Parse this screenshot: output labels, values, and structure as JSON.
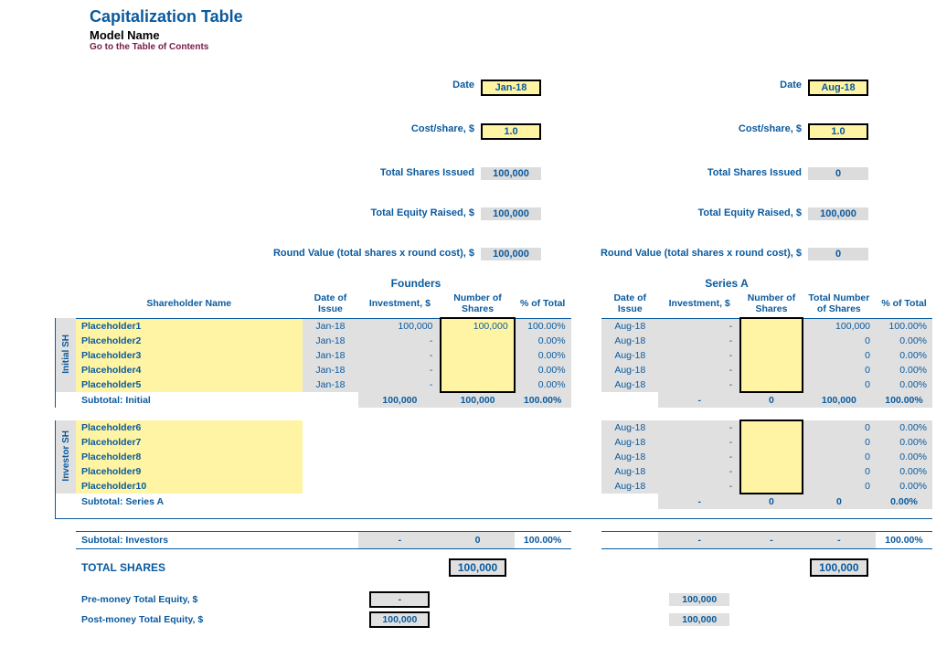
{
  "header": {
    "title": "Capitalization Table",
    "model": "Model Name",
    "toc": "Go to the Table of Contents"
  },
  "rounds": {
    "labels": {
      "date": "Date",
      "cost": "Cost/share, $",
      "issued": "Total Shares Issued",
      "raised": "Total Equity Raised, $",
      "roundval": "Round Value (total shares x round cost), $"
    },
    "founders": {
      "date": "Jan-18",
      "cost": "1.0",
      "issued": "100,000",
      "raised": "100,000",
      "roundval": "100,000"
    },
    "seriesa": {
      "date": "Aug-18",
      "cost": "1.0",
      "issued": "0",
      "raised": "100,000",
      "roundval": "0"
    }
  },
  "sections": {
    "founders": "Founders",
    "seriesa": "Series A"
  },
  "headers": {
    "shname": "Shareholder Name",
    "date": "Date of Issue",
    "invest": "Investment, $",
    "shares": "Number of Shares",
    "total_shares": "Total Number of Shares",
    "pct": "% of Total"
  },
  "sidebars": {
    "initial": "Initial SH",
    "investor": "Investor SH"
  },
  "initial_rows": [
    {
      "name": "Placeholder1",
      "f_date": "Jan-18",
      "f_inv": "100,000",
      "f_sh": "100,000",
      "f_pct": "100.00%",
      "a_date": "Aug-18",
      "a_inv": "-",
      "a_sh": "",
      "a_total": "100,000",
      "a_pct": "100.00%"
    },
    {
      "name": "Placeholder2",
      "f_date": "Jan-18",
      "f_inv": "-",
      "f_sh": "",
      "f_pct": "0.00%",
      "a_date": "Aug-18",
      "a_inv": "-",
      "a_sh": "",
      "a_total": "0",
      "a_pct": "0.00%"
    },
    {
      "name": "Placeholder3",
      "f_date": "Jan-18",
      "f_inv": "-",
      "f_sh": "",
      "f_pct": "0.00%",
      "a_date": "Aug-18",
      "a_inv": "-",
      "a_sh": "",
      "a_total": "0",
      "a_pct": "0.00%"
    },
    {
      "name": "Placeholder4",
      "f_date": "Jan-18",
      "f_inv": "-",
      "f_sh": "",
      "f_pct": "0.00%",
      "a_date": "Aug-18",
      "a_inv": "-",
      "a_sh": "",
      "a_total": "0",
      "a_pct": "0.00%"
    },
    {
      "name": "Placeholder5",
      "f_date": "Jan-18",
      "f_inv": "-",
      "f_sh": "",
      "f_pct": "0.00%",
      "a_date": "Aug-18",
      "a_inv": "-",
      "a_sh": "",
      "a_total": "0",
      "a_pct": "0.00%"
    }
  ],
  "initial_subtotal": {
    "label": "Subtotal: Initial",
    "f_inv": "100,000",
    "f_sh": "100,000",
    "f_pct": "100.00%",
    "a_inv": "-",
    "a_sh": "0",
    "a_total": "100,000",
    "a_pct": "100.00%"
  },
  "investor_rows": [
    {
      "name": "Placeholder6",
      "a_date": "Aug-18",
      "a_inv": "-",
      "a_sh": "",
      "a_total": "0",
      "a_pct": "0.00%"
    },
    {
      "name": "Placeholder7",
      "a_date": "Aug-18",
      "a_inv": "-",
      "a_sh": "",
      "a_total": "0",
      "a_pct": "0.00%"
    },
    {
      "name": "Placeholder8",
      "a_date": "Aug-18",
      "a_inv": "-",
      "a_sh": "",
      "a_total": "0",
      "a_pct": "0.00%"
    },
    {
      "name": "Placeholder9",
      "a_date": "Aug-18",
      "a_inv": "-",
      "a_sh": "",
      "a_total": "0",
      "a_pct": "0.00%"
    },
    {
      "name": "Placeholder10",
      "a_date": "Aug-18",
      "a_inv": "-",
      "a_sh": "",
      "a_total": "0",
      "a_pct": "0.00%"
    }
  ],
  "seriesa_subtotal": {
    "label": "Subtotal: Series A",
    "a_inv": "-",
    "a_sh": "0",
    "a_total": "0",
    "a_pct": "0.00%"
  },
  "subtotal_investors": {
    "label": "Subtotal: Investors",
    "f_inv": "-",
    "f_sh": "0",
    "f_pct": "100.00%",
    "a_inv": "-",
    "a_sh": "-",
    "a_total": "-",
    "a_pct": "100.00%"
  },
  "total_shares": {
    "label": "TOTAL SHARES",
    "founders": "100,000",
    "seriesa": "100,000"
  },
  "equity": {
    "pre_label": "Pre-money Total Equity, $",
    "post_label": "Post-money Total Equity, $",
    "founders_pre": "-",
    "founders_post": "100,000",
    "seriesa_pre": "100,000",
    "seriesa_post": "100,000"
  }
}
